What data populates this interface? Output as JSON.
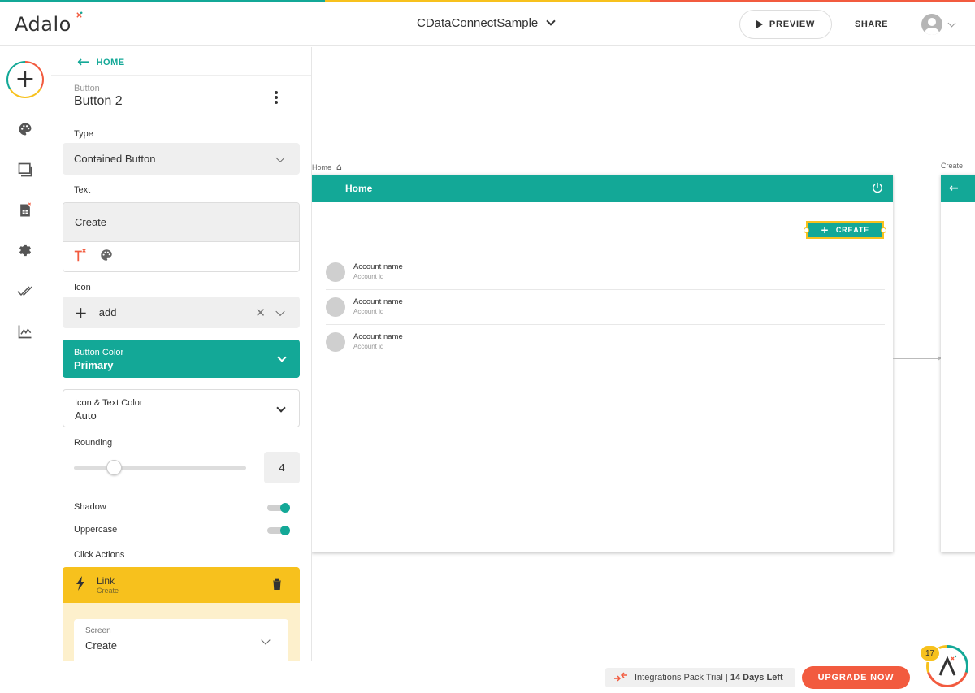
{
  "colors": {
    "teal": "#13a897",
    "yellow": "#f7c11d",
    "orange": "#f25b3f",
    "action_light": "#fdf0cc"
  },
  "header": {
    "logo": "Adalo",
    "app_name": "CDataConnectSample",
    "preview_label": "PREVIEW",
    "share_label": "SHARE"
  },
  "rail": {
    "icons": [
      "add-icon",
      "palette-icon",
      "screens-icon",
      "database-icon",
      "settings-icon",
      "publish-icon",
      "analytics-icon"
    ]
  },
  "panel": {
    "back_label": "HOME",
    "component_type": "Button",
    "component_name": "Button 2",
    "type_label": "Type",
    "type_value": "Contained Button",
    "text_label": "Text",
    "text_value": "Create",
    "icon_label": "Icon",
    "icon_value": "add",
    "button_color_label": "Button Color",
    "button_color_value": "Primary",
    "icon_text_color_label": "Icon & Text Color",
    "icon_text_color_value": "Auto",
    "rounding_label": "Rounding",
    "rounding_value": "4",
    "rounding_fraction": 0.23,
    "shadow_label": "Shadow",
    "shadow_on": true,
    "uppercase_label": "Uppercase",
    "uppercase_on": true,
    "click_actions_label": "Click Actions",
    "action_title": "Link",
    "action_subtitle": "Create",
    "screen_label": "Screen",
    "screen_value": "Create"
  },
  "canvas": {
    "home_screen_label": "Home",
    "home_header_title": "Home",
    "create_button_label": "CREATE",
    "list_items": [
      {
        "title": "Account name",
        "subtitle": "Account id"
      },
      {
        "title": "Account name",
        "subtitle": "Account id"
      },
      {
        "title": "Account name",
        "subtitle": "Account id"
      }
    ],
    "create_screen_label": "Create"
  },
  "footer": {
    "trial_text": "Integrations Pack Trial",
    "trial_days": "14 Days Left",
    "upgrade_label": "UPGRADE NOW",
    "help_badge": "17"
  }
}
